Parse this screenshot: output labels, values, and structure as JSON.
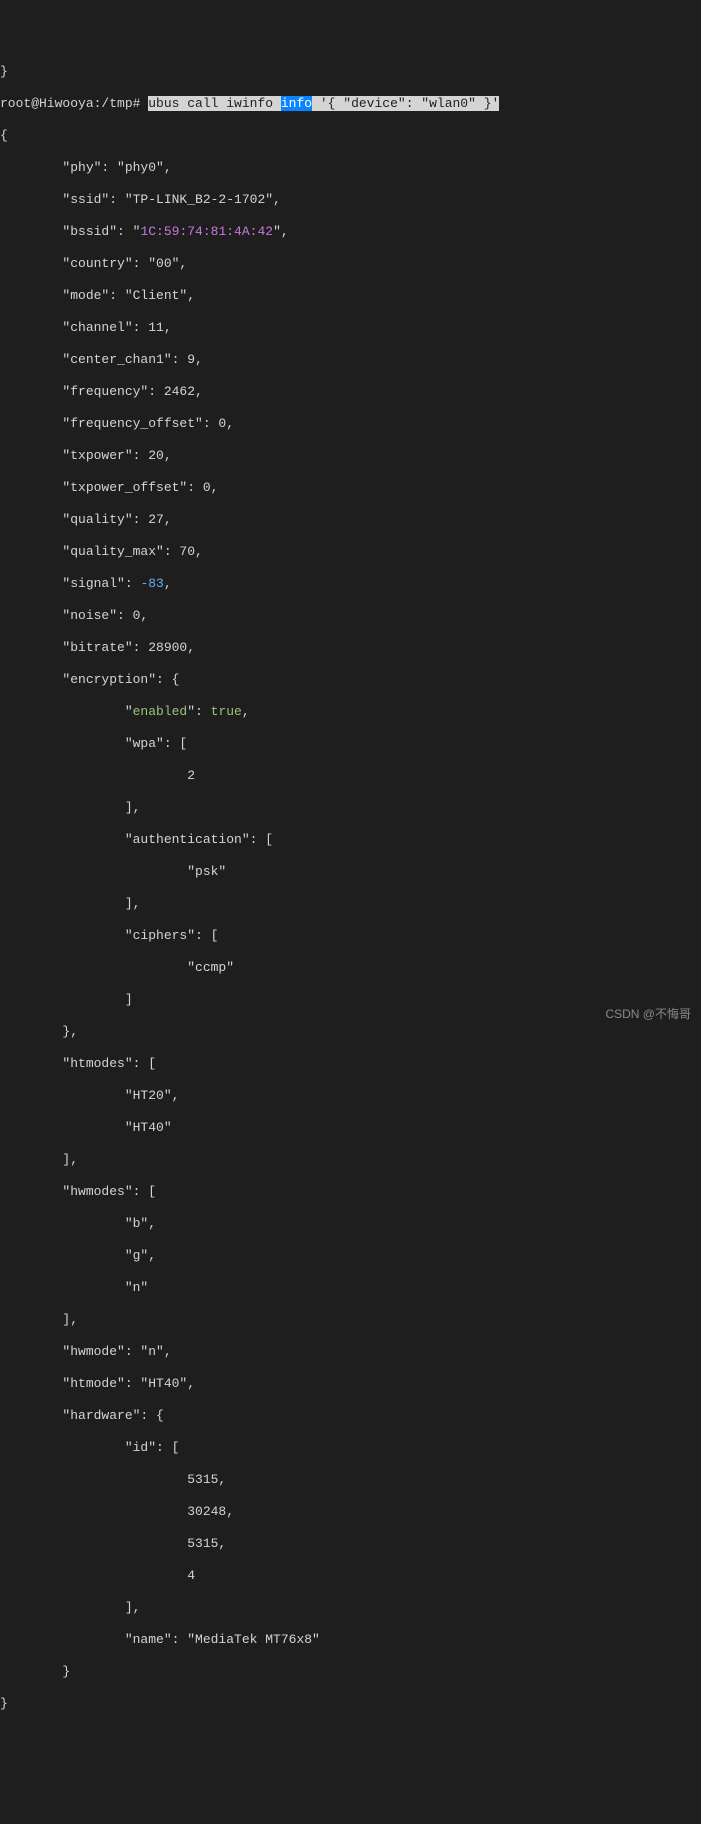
{
  "top_brace": "}",
  "prompt": "root@Hiwooya:/tmp# ",
  "cmd_part1": "ubus call iwinfo ",
  "cmd_info": "info",
  "cmd_part2": " '{ \"device\": \"wlan0\" }'",
  "open_brace": "{",
  "lines": {
    "phy": "        \"phy\": \"phy0\",",
    "ssid": "        \"ssid\": \"TP-LINK_B2-2-1702\",",
    "bssid_pre": "        \"bssid\": \"",
    "bssid_val": "1C:59:74:81:4A:42",
    "bssid_post": "\",",
    "country": "        \"country\": \"00\",",
    "mode": "        \"mode\": \"Client\",",
    "channel": "        \"channel\": 11,",
    "center_chan1": "        \"center_chan1\": 9,",
    "frequency": "        \"frequency\": 2462,",
    "freq_offset": "        \"frequency_offset\": 0,",
    "txpower": "        \"txpower\": 20,",
    "txpower_off": "        \"txpower_offset\": 0,",
    "quality": "        \"quality\": 27,",
    "quality_max": "        \"quality_max\": 70,",
    "signal_pre": "        \"signal\": ",
    "signal_val": "-83",
    "signal_post": ",",
    "noise": "        \"noise\": 0,",
    "bitrate": "        \"bitrate\": 28900,",
    "encryption": "        \"encryption\": {",
    "enabled_pre": "                \"",
    "enabled_key": "enabled",
    "enabled_mid": "\": ",
    "enabled_val": "true",
    "enabled_post": ",",
    "wpa_open": "                \"wpa\": [",
    "wpa_val": "                        2",
    "wpa_close": "                ],",
    "auth_open": "                \"authentication\": [",
    "auth_val": "                        \"psk\"",
    "auth_close": "                ],",
    "ciphers_open": "                \"ciphers\": [",
    "ciphers_val": "                        \"ccmp\"",
    "ciphers_close": "                ]",
    "enc_close": "        },",
    "htmodes_open": "        \"htmodes\": [",
    "htmodes_v1": "                \"HT20\",",
    "htmodes_v2": "                \"HT40\"",
    "htmodes_close": "        ],",
    "hwmodes_open": "        \"hwmodes\": [",
    "hwmodes_v1": "                \"b\",",
    "hwmodes_v2": "                \"g\",",
    "hwmodes_v3": "                \"n\"",
    "hwmodes_close": "        ],",
    "hwmode": "        \"hwmode\": \"n\",",
    "htmode": "        \"htmode\": \"HT40\",",
    "hardware": "        \"hardware\": {",
    "id_open": "                \"id\": [",
    "id_v1": "                        5315,",
    "id_v2": "                        30248,",
    "id_v3": "                        5315,",
    "id_v4": "                        4",
    "id_close": "                ],",
    "hw_name": "                \"name\": \"MediaTek MT76x8\"",
    "hw_close": "        }",
    "final_close": "}"
  },
  "watermark": "CSDN @不悔哥"
}
